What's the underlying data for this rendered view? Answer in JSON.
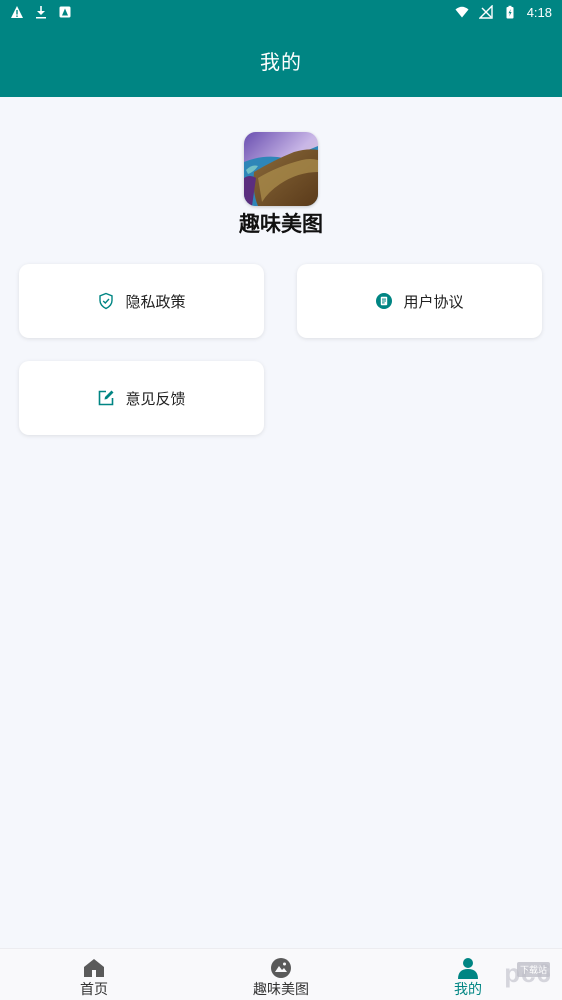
{
  "status_bar": {
    "time": "4:18",
    "left_icons": [
      "warning-icon",
      "download-icon",
      "app-notification-icon"
    ],
    "right_icons": [
      "wifi-icon",
      "no-signal-icon",
      "battery-charging-icon"
    ]
  },
  "app_bar": {
    "title": "我的"
  },
  "profile": {
    "app_name": "趣味美图",
    "logo_icon": "app-logo-landscape"
  },
  "cards": {
    "privacy": {
      "label": "隐私政策",
      "icon": "shield-check-icon"
    },
    "agreement": {
      "label": "用户协议",
      "icon": "document-icon"
    },
    "feedback": {
      "label": "意见反馈",
      "icon": "edit-icon"
    }
  },
  "bottom_nav": {
    "items": [
      {
        "label": "首页",
        "icon": "home-icon"
      },
      {
        "label": "趣味美图",
        "icon": "image-icon"
      },
      {
        "label": "我的",
        "icon": "person-icon",
        "active": true
      }
    ]
  },
  "watermark": {
    "text": "pc6",
    "suffix": "下载站"
  },
  "colors": {
    "primary": "#008583",
    "background": "#f5f7fc",
    "card": "#ffffff",
    "text": "#222222"
  }
}
